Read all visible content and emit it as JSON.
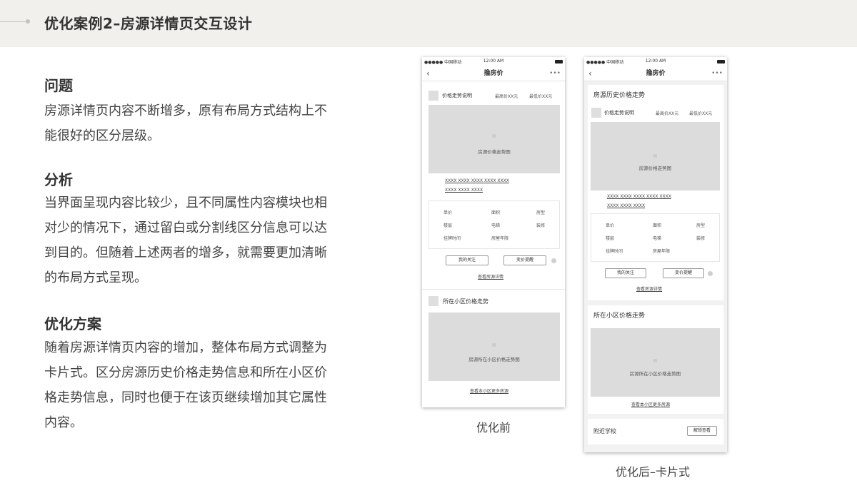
{
  "header": {
    "title": "优化案例2–房源详情页交互设计"
  },
  "sections": [
    {
      "title": "问题",
      "body": "房源详情页内容不断增多，原有布局方式结构上不能很好的区分层级。"
    },
    {
      "title": "分析",
      "body": "当界面呈现内容比较少，且不同属性内容模块也相对少的情况下，通过留白或分割线区分信息可以达到目的。但随着上述两者的增多，就需要更加清晰的布局方式呈现。"
    },
    {
      "title": "优化方案",
      "body": "随着房源详情页内容的增加，整体布局方式调整为卡片式。区分房源历史价格走势信息和所在小区价格走势信息，同时也便于在该页继续增加其它属性内容。"
    }
  ],
  "phone_common": {
    "carrier": "●●●●● 中国移动",
    "time": "12:00 AM",
    "nav_title": "撸房价",
    "back_icon": "‹",
    "more_icon": "•••",
    "price_trend_label": "价格走势说明",
    "max_price": "最高价XX元",
    "min_price": "最低价XX元",
    "chart_icon": "▤",
    "price_chart_label": "房源价格走势图",
    "xxxx_line1": "XXXX XXXX  XXXX XXXX   XXXX",
    "xxxx_line2": "XXXX XXXX  XXXX",
    "attrs": {
      "unit_price": "单价",
      "area": "面积",
      "layout": "房型",
      "floor": "楼层",
      "elevator": "电梯",
      "decoration": "装修",
      "listing_time": "挂牌时间",
      "house_age": "房屋年限"
    },
    "follow_button": "我的关注",
    "price_alert_button": "变价提醒",
    "view_detail_link": "查看房源详情",
    "community_trend_title": "所在小区价格走势",
    "community_chart_label": "房源所在小区价格走势图",
    "more_listings_link": "查看本小区更多房源"
  },
  "phone_after": {
    "history_card_title": "房源历史价格走势",
    "school_title": "附近学校",
    "unlock_button": "解锁查看"
  },
  "captions": {
    "before": "优化前",
    "after": "优化后–卡片式"
  }
}
